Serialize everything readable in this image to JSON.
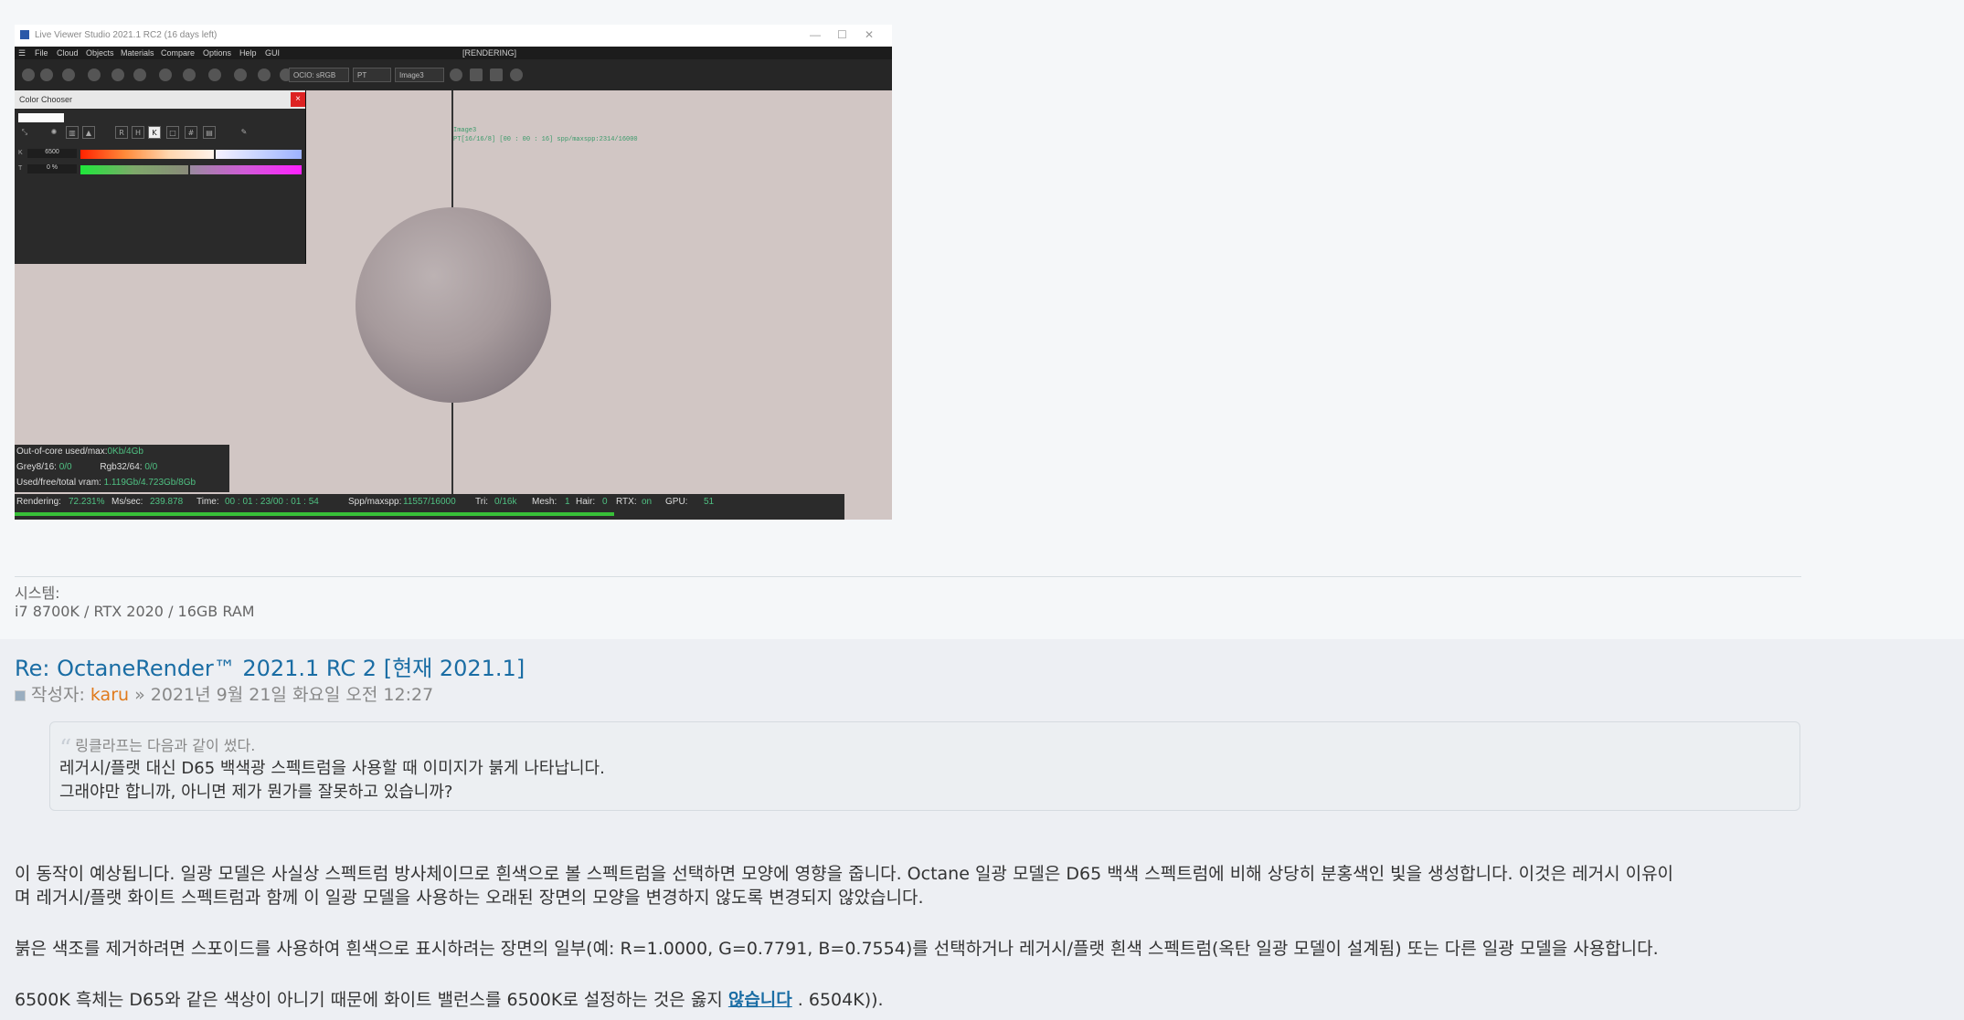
{
  "screenshot": {
    "window_title": "Live Viewer Studio 2021.1 RC2 (16 days left)",
    "menu": [
      "File",
      "Cloud",
      "Objects",
      "Materials",
      "Compare",
      "Options",
      "Help",
      "GUI"
    ],
    "render_state": "[RENDERING]",
    "toolbar_selects": [
      "OCIO: sRGB",
      "PT",
      "Image3"
    ],
    "overlay_lines": [
      "Image3",
      "PT[16/16/8] [00 : 00 : 16]  spp/maxspp:2314/16000"
    ],
    "color_chooser": {
      "title": "Color Chooser",
      "close": "×",
      "mode_buttons": [
        "R",
        "H",
        "K",
        "□",
        "#",
        "▤"
      ],
      "k_label": "K",
      "k_value": "6500",
      "t_label": "T",
      "t_value": "0 %"
    },
    "stats": {
      "ooc_label": "Out-of-core used/max:",
      "ooc_value": "0Kb/4Gb",
      "grey_label": "Grey8/16:",
      "grey_value": "0/0",
      "rgb_label": "Rgb32/64:",
      "rgb_value": "0/0",
      "vram_label": "Used/free/total vram:",
      "vram_value": "1.119Gb/4.723Gb/8Gb"
    },
    "status": {
      "rendering_label": "Rendering:",
      "rendering_value": "72.231%",
      "ms_label": "Ms/sec:",
      "ms_value": "239.878",
      "time_label": "Time:",
      "time_value": "00 : 01 : 23/00 : 01 : 54",
      "spp_label": "Spp/maxspp:",
      "spp_value": "11557/16000",
      "tri_label": "Tri:",
      "tri_value": "0/16k",
      "mesh_label": "Mesh:",
      "mesh_value": "1",
      "hair_label": "Hair:",
      "hair_value": "0",
      "rtx_label": "RTX:",
      "rtx_value": "on",
      "gpu_label": "GPU:",
      "gpu_value": "51",
      "progress": 0.72231
    }
  },
  "system": {
    "label": "시스템:",
    "value": "i7 8700K / RTX 2020 / 16GB RAM"
  },
  "post": {
    "title": "Re: OctaneRender™ 2021.1 RC 2 [현재 2021.1]",
    "author_prefix": "작성자:",
    "author": "karu",
    "date": "» 2021년 9월 21일 화요일 오전 12:27",
    "quote": {
      "cite": "링클라프는 다음과 같이 썼다.",
      "line1": "레거시/플랫 대신 D65 백색광 스펙트럼을 사용할 때 이미지가 붉게 나타납니다.",
      "line2": "그래야만 합니까, 아니면 제가 뭔가를 잘못하고 있습니까?"
    },
    "p1_line1": "이 동작이 예상됩니다. 일광 모델은 사실상 스펙트럼 방사체이므로 흰색으로 볼 스펙트럼을 선택하면 모양에 영향을 줍니다. Octane 일광 모델은 D65 백색 스펙트럼에 비해 상당히 분홍색인 빛을 생성합니다. 이것은 레거시 이유이",
    "p1_line2": "며 레거시/플랫 화이트 스펙트럼과 함께 이 일광 모델을 사용하는 오래된 장면의 모양을 변경하지 않도록 변경되지 않았습니다.",
    "p2": "붉은 색조를 제거하려면 스포이드를 사용하여 흰색으로 표시하려는 장면의 일부(예: R=1.0000, G=0.7791, B=0.7554)를 선택하거나 레거시/플랫 흰색 스펙트럼(옥탄 일광 모델이 설계됨) 또는 다른 일광 모델을 사용합니다.",
    "p3_before": "6500K 흑체는 D65와 같은 색상이 아니기 때문에 화이트 밸런스를 6500K로 설정하는 것은 옳지 ",
    "p3_link": "않습니다",
    "p3_after": " . 6504K))."
  }
}
